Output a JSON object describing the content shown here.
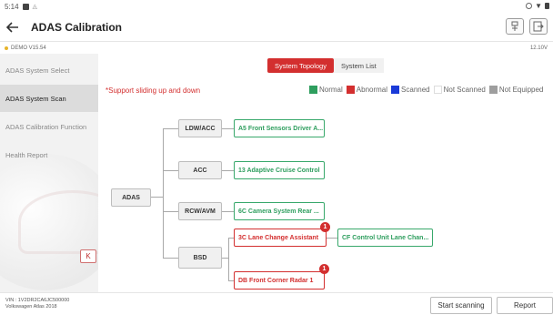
{
  "statusbar": {
    "time": "5:14"
  },
  "titlebar": {
    "title": "ADAS Calibration"
  },
  "version": {
    "text": "DEMO V15.54",
    "voltage": "12.10V"
  },
  "sidebar": {
    "items": [
      {
        "label": "ADAS System Select"
      },
      {
        "label": "ADAS System Scan"
      },
      {
        "label": "ADAS Calibration Function"
      },
      {
        "label": "Health Report"
      }
    ],
    "collapse_glyph": "K"
  },
  "main": {
    "tabs": [
      {
        "label": "System Topology"
      },
      {
        "label": "System List"
      }
    ],
    "support_text": "*Support sliding up and down",
    "legend": [
      {
        "label": "Normal",
        "color": "#2e9e5e"
      },
      {
        "label": "Abnormal",
        "color": "#d32f2f"
      },
      {
        "label": "Scanned",
        "color": "#1a3ad8"
      },
      {
        "label": "Not Scanned",
        "color": "#ffffff"
      },
      {
        "label": "Not Equipped",
        "color": "#9e9e9e"
      }
    ]
  },
  "topology": {
    "root": "ADAS",
    "groups": [
      {
        "label": "LDW/ACC"
      },
      {
        "label": "ACC"
      },
      {
        "label": "RCW/AVM"
      },
      {
        "label": "BSD"
      }
    ],
    "modules": [
      {
        "label": "A5 Front Sensors Driver A...",
        "status": "normal"
      },
      {
        "label": "13 Adaptive Cruise Control",
        "status": "normal"
      },
      {
        "label": "6C Camera System Rear ...",
        "status": "normal"
      },
      {
        "label": "3C Lane Change Assistant",
        "status": "abnormal",
        "badge": "1"
      },
      {
        "label": "DB Front Corner Radar 1",
        "status": "abnormal",
        "badge": "1"
      },
      {
        "label": "CF Control Unit Lane Chan...",
        "status": "normal"
      }
    ]
  },
  "bottombar": {
    "vin": "VIN : 1V2DR2CA6JC500000",
    "vehicle": "Volkswagen Atlas 2018",
    "scan_label": "Start scanning",
    "report_label": "Report"
  }
}
